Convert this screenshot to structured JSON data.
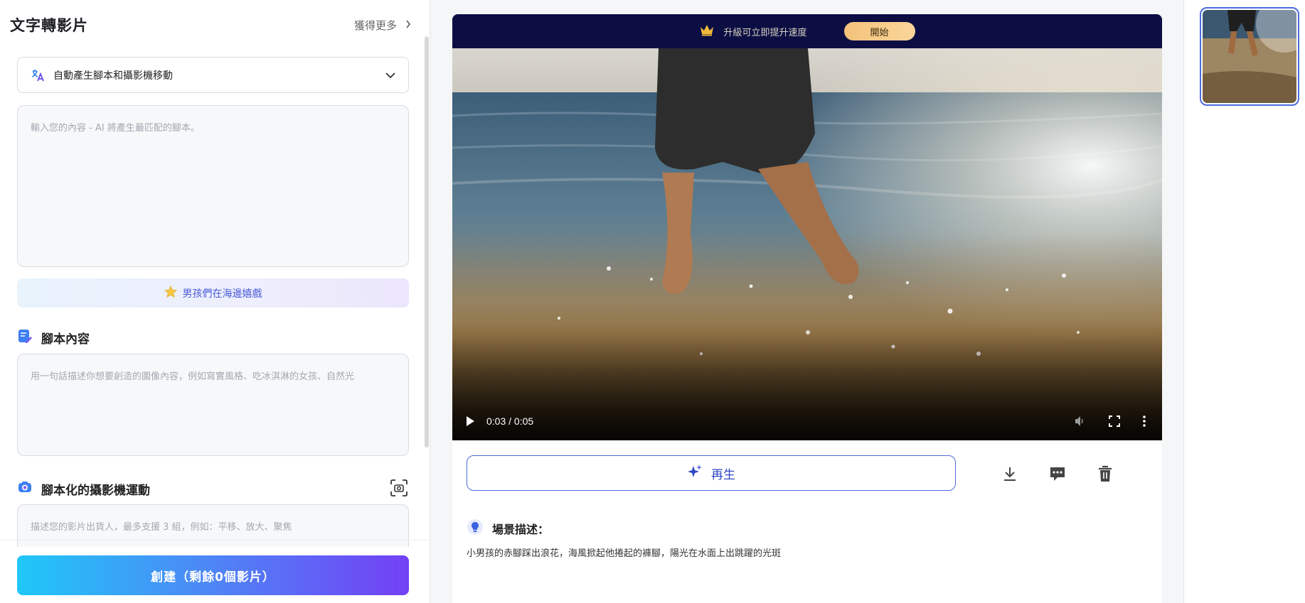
{
  "left_panel": {
    "title": "文字轉影片",
    "get_more": "獲得更多",
    "mode_select": {
      "value": "自動產生腳本和攝影機移動"
    },
    "prompt_input": {
      "placeholder": "輸入您的內容 - AI 將產生最匹配的腳本。",
      "value": ""
    },
    "example_chip": "男孩們在海邊嬉戲",
    "script_section": {
      "title": "腳本內容",
      "placeholder": "用一句話描述你想要創造的圖像內容，例如寫實風格、吃冰淇淋的女孩、自然光"
    },
    "camera_section": {
      "title": "腳本化的攝影機運動",
      "placeholder": "描述您的影片出貨人，最多支援 3 組，例如：平移、放大、聚焦"
    },
    "create_button": "創建（剩餘0個影片）"
  },
  "center": {
    "upgrade_banner": {
      "text": "升級可立即提升速度",
      "button": "開始"
    },
    "video": {
      "time": "0:03 / 0:05",
      "progress": 0.6
    },
    "regenerate_button": "再生",
    "scene_description": {
      "title": "場景描述：",
      "text": "小男孩的赤腳踩出浪花，海風掀起他捲起的褲腳，陽光在水面上出跳躍的光斑"
    }
  },
  "colors": {
    "accent": "#3047c4",
    "banner_bg": "#0c0e43",
    "start_button": "#f5c57f"
  }
}
